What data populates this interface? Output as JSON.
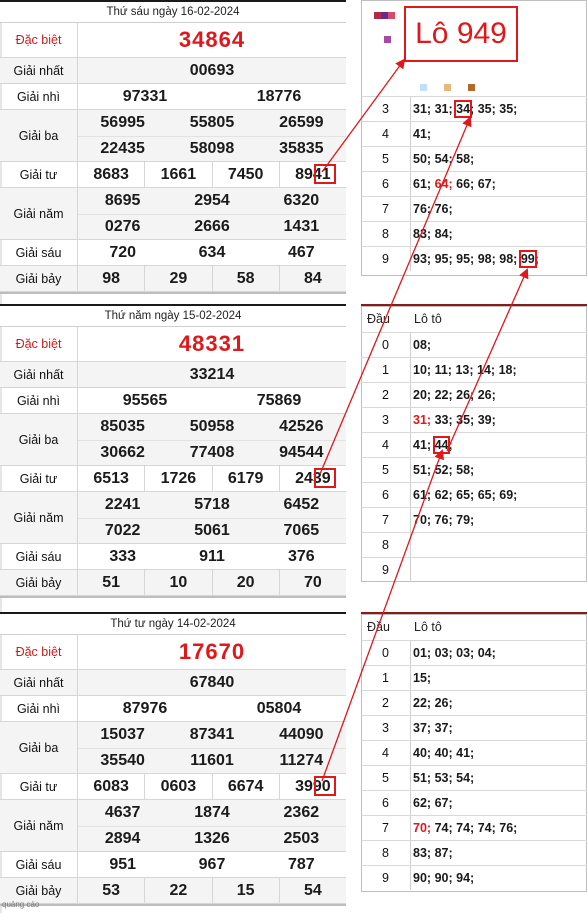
{
  "panels": [
    {
      "header": "Thứ sáu ngày 16-02-2024",
      "labels": {
        "db": "Đặc biệt",
        "g1": "Giải nhất",
        "g2": "Giải nhì",
        "g3": "Giải ba",
        "g4": "Giải tư",
        "g5": "Giải năm",
        "g6": "Giải sáu",
        "g7": "Giải bảy"
      },
      "db": "34864",
      "g1": [
        "00693"
      ],
      "g2": [
        "97331",
        "18776"
      ],
      "g3": [
        "56995",
        "55805",
        "26599",
        "22435",
        "58098",
        "35835"
      ],
      "g4": [
        "8683",
        "1661",
        "7450",
        "8941"
      ],
      "g5": [
        "8695",
        "2954",
        "6320",
        "0276",
        "2666",
        "1431"
      ],
      "g6": [
        "720",
        "634",
        "467"
      ],
      "g7": [
        "98",
        "29",
        "58",
        "84"
      ]
    },
    {
      "header": "Thứ năm ngày 15-02-2024",
      "labels": {
        "db": "Đặc biệt",
        "g1": "Giải nhất",
        "g2": "Giải nhì",
        "g3": "Giải ba",
        "g4": "Giải tư",
        "g5": "Giải năm",
        "g6": "Giải sáu",
        "g7": "Giải bảy"
      },
      "db": "48331",
      "g1": [
        "33214"
      ],
      "g2": [
        "95565",
        "75869"
      ],
      "g3": [
        "85035",
        "50958",
        "42526",
        "30662",
        "77408",
        "94544"
      ],
      "g4": [
        "6513",
        "1726",
        "6179",
        "2439"
      ],
      "g5": [
        "2241",
        "5718",
        "6452",
        "7022",
        "5061",
        "7065"
      ],
      "g6": [
        "333",
        "911",
        "376"
      ],
      "g7": [
        "51",
        "10",
        "20",
        "70"
      ]
    },
    {
      "header": "Thứ tư ngày 14-02-2024",
      "labels": {
        "db": "Đặc biệt",
        "g1": "Giải nhất",
        "g2": "Giải nhì",
        "g3": "Giải ba",
        "g4": "Giải tư",
        "g5": "Giải năm",
        "g6": "Giải sáu",
        "g7": "Giải bảy"
      },
      "db": "17670",
      "g1": [
        "67840"
      ],
      "g2": [
        "87976",
        "05804"
      ],
      "g3": [
        "15037",
        "87341",
        "44090",
        "35540",
        "11601",
        "11274"
      ],
      "g4": [
        "6083",
        "0603",
        "6674",
        "3990"
      ],
      "g5": [
        "4637",
        "1874",
        "2362",
        "2894",
        "1326",
        "2503"
      ],
      "g6": [
        "951",
        "967",
        "787"
      ],
      "g7": [
        "53",
        "22",
        "15",
        "54"
      ]
    }
  ],
  "callout": "Lô 949",
  "loto_tables": [
    {
      "show_header": false,
      "rows": [
        {
          "dau": "3",
          "vals": "31; 31; 34; 35; 35;"
        },
        {
          "dau": "4",
          "vals": "41;"
        },
        {
          "dau": "5",
          "vals": "50; 54; 58;"
        },
        {
          "dau": "6",
          "vals": "61; 64; 66; 67;"
        },
        {
          "dau": "7",
          "vals": "76; 76;"
        },
        {
          "dau": "8",
          "vals": "83; 84;"
        },
        {
          "dau": "9",
          "vals": "93; 95; 95; 98; 98; 99;"
        }
      ]
    },
    {
      "show_header": true,
      "header": {
        "dau": "Đầu",
        "loto": "Lô tô"
      },
      "rows": [
        {
          "dau": "0",
          "vals": "08;"
        },
        {
          "dau": "1",
          "vals": "10; 11; 13; 14; 18;"
        },
        {
          "dau": "2",
          "vals": "20; 22; 26; 26;"
        },
        {
          "dau": "3",
          "vals": "31; 33; 35; 39;"
        },
        {
          "dau": "4",
          "vals": "41; 44;"
        },
        {
          "dau": "5",
          "vals": "51; 52; 58;"
        },
        {
          "dau": "6",
          "vals": "61; 62; 65; 65; 69;"
        },
        {
          "dau": "7",
          "vals": "70; 76; 79;"
        },
        {
          "dau": "8",
          "vals": ""
        },
        {
          "dau": "9",
          "vals": ""
        }
      ]
    },
    {
      "show_header": true,
      "header": {
        "dau": "Đầu",
        "loto": "Lô tô"
      },
      "rows": [
        {
          "dau": "0",
          "vals": "01; 03; 03; 04;"
        },
        {
          "dau": "1",
          "vals": "15;"
        },
        {
          "dau": "2",
          "vals": "22; 26;"
        },
        {
          "dau": "3",
          "vals": "37; 37;"
        },
        {
          "dau": "4",
          "vals": "40; 40; 41;"
        },
        {
          "dau": "5",
          "vals": "51; 53; 54;"
        },
        {
          "dau": "6",
          "vals": "62; 67;"
        },
        {
          "dau": "7",
          "vals": "70; 74; 74; 74; 76;"
        },
        {
          "dau": "8",
          "vals": "83; 87;"
        },
        {
          "dau": "9",
          "vals": "90; 90; 94;"
        }
      ]
    }
  ],
  "ad_label": "quảng cáo",
  "colors": {
    "accent": "#e0171b",
    "header_rule": "#1a1a1a",
    "loto_rule": "#8b1a1a"
  }
}
